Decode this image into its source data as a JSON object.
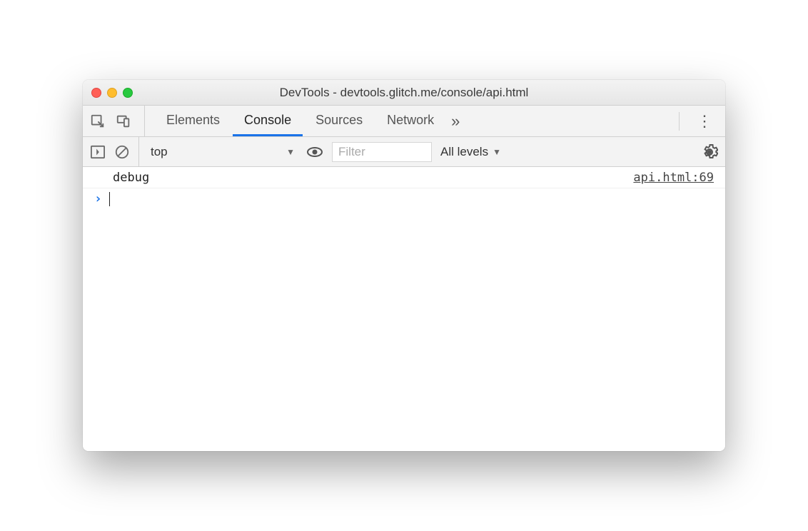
{
  "window": {
    "title": "DevTools - devtools.glitch.me/console/api.html"
  },
  "tabs": {
    "elements": "Elements",
    "console": "Console",
    "sources": "Sources",
    "network": "Network"
  },
  "filterbar": {
    "context": "top",
    "filter_placeholder": "Filter",
    "levels": "All levels"
  },
  "console": {
    "entries": [
      {
        "message": "debug",
        "source": "api.html:69"
      }
    ]
  }
}
